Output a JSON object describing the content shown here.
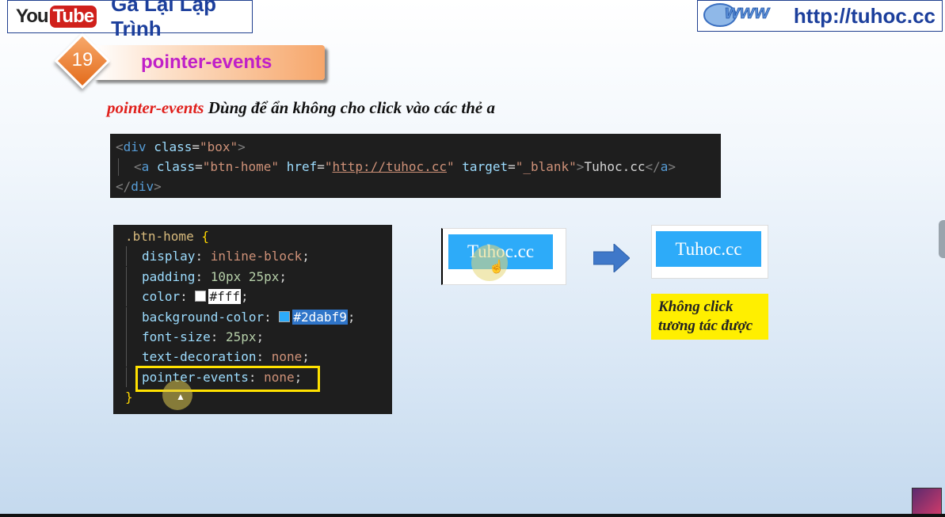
{
  "header": {
    "youtube_you": "You",
    "youtube_tube": "Tube",
    "channel_name": "Gà Lại Lập Trình",
    "site_url": "http://tuhoc.cc"
  },
  "lesson": {
    "number": "19",
    "title": "pointer-events"
  },
  "subtitle": {
    "keyword": "pointer-events",
    "text": " Dùng để ẩn không cho click vào các thẻ a"
  },
  "html_code": {
    "line1_tag_open": "<",
    "line1_tag": "div",
    "line1_attr": "class",
    "line1_value": "\"box\"",
    "line1_close": ">",
    "line2_open": "<",
    "line2_tag": "a",
    "line2_attr1": "class",
    "line2_val1": "\"btn-home\"",
    "line2_attr2": "href",
    "line2_val2_q1": "\"",
    "line2_val2": "http://tuhoc.cc",
    "line2_val2_q2": "\"",
    "line2_attr3": "target",
    "line2_val3": "\"_blank\"",
    "line2_gt": ">",
    "line2_text": "Tuhoc.cc",
    "line2_end_open": "</",
    "line2_end_tag": "a",
    "line2_end_close": ">",
    "line3_open": "</",
    "line3_tag": "div",
    "line3_close": ">"
  },
  "css_code": {
    "selector": ".btn-home",
    "open_brace": "{",
    "close_brace": "}",
    "props": [
      {
        "name": "display",
        "value": "inline-block"
      },
      {
        "name": "padding",
        "value": "10px 25px"
      },
      {
        "name": "color",
        "value": "#fff"
      },
      {
        "name": "background-color",
        "value": "#2dabf9"
      },
      {
        "name": "font-size",
        "value": "25px"
      },
      {
        "name": "text-decoration",
        "value": "none"
      },
      {
        "name": "pointer-events",
        "value": "none"
      }
    ],
    "colon": ": ",
    "semicolon": ";"
  },
  "demo": {
    "button_text_before": "Tuhoc.cc",
    "button_text_after": "Tuhoc.cc",
    "button_color": "#2dabf9",
    "note_line1": "Không click",
    "note_line2": "tương tác được"
  },
  "colors": {
    "header_blue": "#1c3f9c",
    "title_magenta": "#c020c8",
    "keyword_red": "#e0201c",
    "badge_orange": "#e36c1c",
    "note_yellow": "#ffef00"
  },
  "icons": [
    "hand-pointer-icon",
    "arrow-right-icon",
    "mouse-cursor-icon"
  ]
}
